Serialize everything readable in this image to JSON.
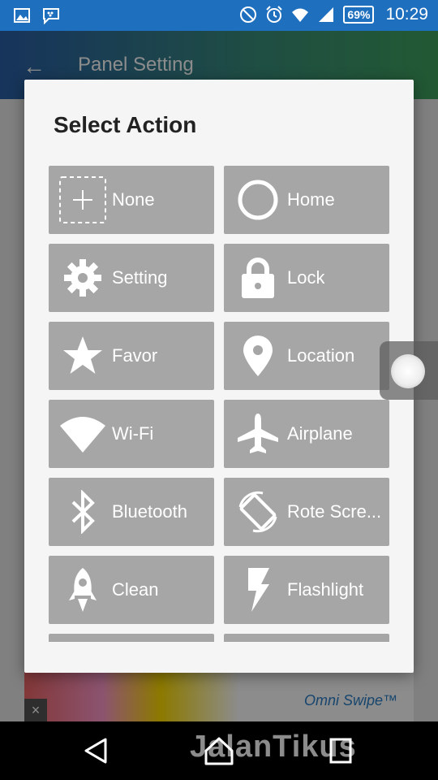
{
  "status_bar": {
    "battery": "69%",
    "time": "10:29",
    "icons": [
      "gallery-icon",
      "bbm-icon",
      "do-not-disturb-icon",
      "alarm-icon",
      "wifi-icon",
      "signal-icon",
      "battery-icon"
    ]
  },
  "app_bar": {
    "title": "Panel Setting"
  },
  "dialog": {
    "title": "Select Action",
    "actions": [
      {
        "label": "None",
        "icon": "plus-dashed-icon"
      },
      {
        "label": "Home",
        "icon": "circle-icon"
      },
      {
        "label": "Setting",
        "icon": "gear-icon"
      },
      {
        "label": "Lock",
        "icon": "lock-icon"
      },
      {
        "label": "Favor",
        "icon": "star-icon"
      },
      {
        "label": "Location",
        "icon": "location-pin-icon"
      },
      {
        "label": "Wi-Fi",
        "icon": "wifi-icon"
      },
      {
        "label": "Airplane",
        "icon": "airplane-icon"
      },
      {
        "label": "Bluetooth",
        "icon": "bluetooth-icon"
      },
      {
        "label": "Rote Scre...",
        "icon": "rotate-screen-icon"
      },
      {
        "label": "Clean",
        "icon": "rocket-icon"
      },
      {
        "label": "Flashlight",
        "icon": "flashlight-icon"
      }
    ]
  },
  "ad": {
    "brand": "Omni Swipe™",
    "close": "×"
  },
  "watermark": "JalanTikus",
  "colors": {
    "tile": "#a6a6a6",
    "dialog": "#f5f5f5",
    "status_bar": "#1f6fbf"
  }
}
